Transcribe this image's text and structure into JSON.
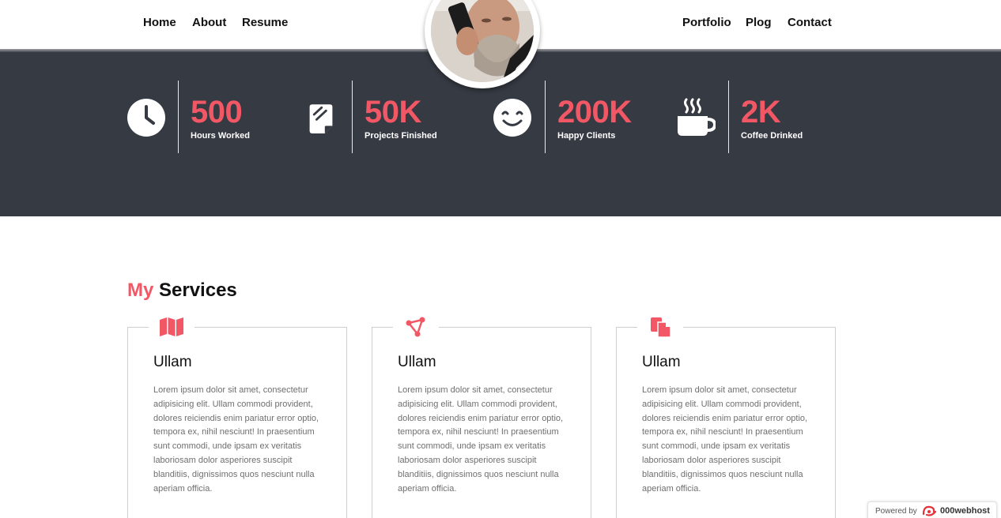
{
  "nav": {
    "left": [
      "Home",
      "About",
      "Resume"
    ],
    "right": [
      "Portfolio",
      "Plog",
      "Contact"
    ]
  },
  "stats": [
    {
      "icon": "clock-icon",
      "value": "500",
      "label": "Hours Worked"
    },
    {
      "icon": "document-icon",
      "value": "50K",
      "label": "Projects Finished"
    },
    {
      "icon": "smiley-icon",
      "value": "200K",
      "label": "Happy Clients"
    },
    {
      "icon": "coffee-cup-icon",
      "value": "2K",
      "label": "Coffee Drinked"
    }
  ],
  "services": {
    "title_accent": "My",
    "title_rest": "Services",
    "cards": [
      {
        "icon": "map-icon",
        "title": "Ullam",
        "text": "Lorem ipsum dolor sit amet, consectetur adipisicing elit. Ullam commodi provident, dolores reiciendis enim pariatur error optio, tempora ex, nihil nesciunt! In praesentium sunt commodi, unde ipsam ex veritatis laboriosam dolor asperiores suscipit blanditiis, dignissimos quos nesciunt nulla aperiam officia."
      },
      {
        "icon": "vector-nodes-icon",
        "title": "Ullam",
        "text": "Lorem ipsum dolor sit amet, consectetur adipisicing elit. Ullam commodi provident, dolores reiciendis enim pariatur error optio, tempora ex, nihil nesciunt! In praesentium sunt commodi, unde ipsam ex veritatis laboriosam dolor asperiores suscipit blanditiis, dignissimos quos nesciunt nulla aperiam officia."
      },
      {
        "icon": "copy-files-icon",
        "title": "Ullam",
        "text": "Lorem ipsum dolor sit amet, consectetur adipisicing elit. Ullam commodi provident, dolores reiciendis enim pariatur error optio, tempora ex, nihil nesciunt! In praesentium sunt commodi, unde ipsam ex veritatis laboriosam dolor asperiores suscipit blanditiis, dignissimos quos nesciunt nulla aperiam officia."
      }
    ]
  },
  "powered": {
    "prefix": "Powered by",
    "brand": "000webhost"
  },
  "colors": {
    "accent": "#f25766",
    "dark_band": "#363a43"
  }
}
